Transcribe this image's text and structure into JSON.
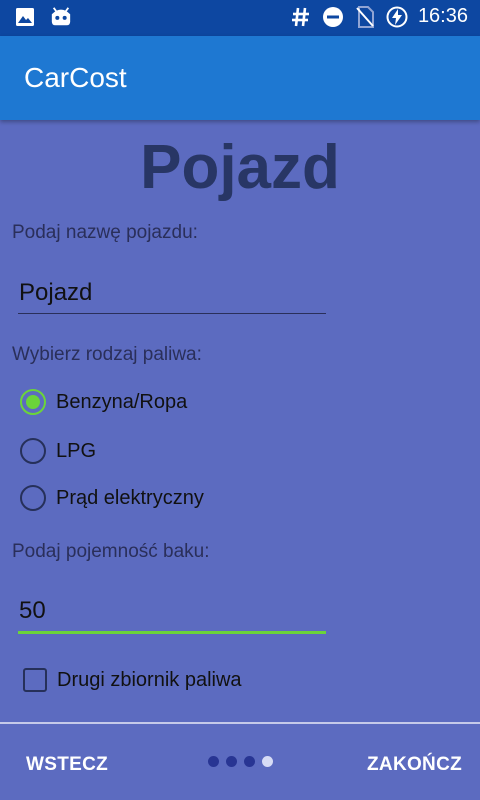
{
  "status_bar": {
    "left_icons": [
      "image-icon",
      "android-debug-icon"
    ],
    "right_icons": [
      "hash-icon",
      "do-not-disturb-icon",
      "no-sim-icon",
      "battery-charging-icon"
    ],
    "time": "16:36"
  },
  "app_bar": {
    "title": "CarCost"
  },
  "page": {
    "title": "Pojazd",
    "name_label": "Podaj nazwę pojazdu:",
    "name_value": "Pojazd",
    "fuel_label": "Wybierz rodzaj paliwa:",
    "fuel_options": [
      {
        "label": "Benzyna/Ropa",
        "checked": true
      },
      {
        "label": "LPG",
        "checked": false
      },
      {
        "label": "Prąd elektryczny",
        "checked": false
      }
    ],
    "tank_label": "Podaj pojemność baku:",
    "tank_value": "50",
    "second_tank_label": "Drugi zbiornik paliwa",
    "second_tank_checked": false
  },
  "footer": {
    "back_label": "WSTECZ",
    "finish_label": "ZAKOŃCZ",
    "page_count": 4,
    "current_page": 4
  },
  "colors": {
    "background": "#5c6bc0",
    "app_bar": "#1e78d2",
    "status_bar": "#0d47a1",
    "accent": "#6bd43a",
    "title": "#283665"
  }
}
